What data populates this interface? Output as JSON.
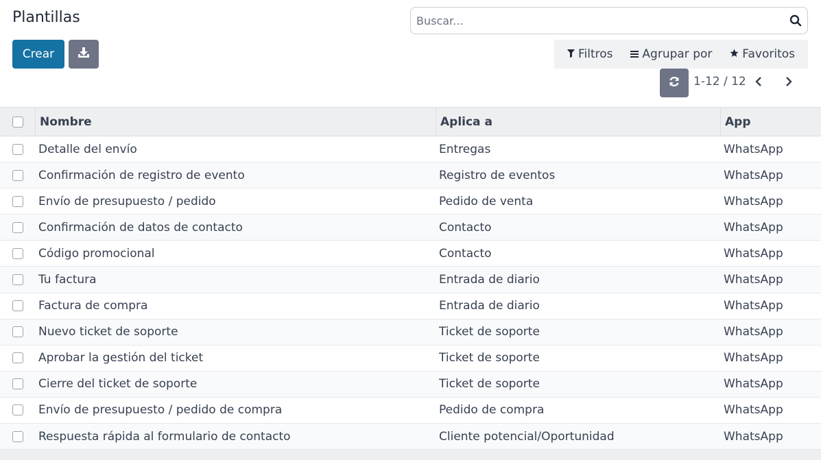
{
  "page": {
    "title": "Plantillas"
  },
  "search": {
    "placeholder": "Buscar...",
    "value": "",
    "icon": "search-icon"
  },
  "toolbar": {
    "create_label": "Crear",
    "download_icon": "download-icon",
    "accent_color": "#1572a3"
  },
  "filters": {
    "filters_label": "Filtros",
    "group_by_label": "Agrupar por",
    "favorites_label": "Favoritos"
  },
  "pager": {
    "value": "1-12 / 12"
  },
  "table": {
    "columns": [
      "Nombre",
      "Aplica a",
      "App"
    ],
    "rows": [
      {
        "name": "Detalle del envío",
        "applies_to": "Entregas",
        "app": "WhatsApp"
      },
      {
        "name": "Confirmación de registro de evento",
        "applies_to": "Registro de eventos",
        "app": "WhatsApp"
      },
      {
        "name": "Envío de presupuesto / pedido",
        "applies_to": "Pedido de venta",
        "app": "WhatsApp"
      },
      {
        "name": "Confirmación de datos de contacto",
        "applies_to": "Contacto",
        "app": "WhatsApp"
      },
      {
        "name": "Código promocional",
        "applies_to": "Contacto",
        "app": "WhatsApp"
      },
      {
        "name": "Tu factura",
        "applies_to": "Entrada de diario",
        "app": "WhatsApp"
      },
      {
        "name": "Factura de compra",
        "applies_to": "Entrada de diario",
        "app": "WhatsApp"
      },
      {
        "name": "Nuevo ticket de soporte",
        "applies_to": "Ticket de soporte",
        "app": "WhatsApp"
      },
      {
        "name": "Aprobar la gestión del ticket",
        "applies_to": "Ticket de soporte",
        "app": "WhatsApp"
      },
      {
        "name": "Cierre del ticket de soporte",
        "applies_to": "Ticket de soporte",
        "app": "WhatsApp"
      },
      {
        "name": "Envío de presupuesto / pedido de compra",
        "applies_to": "Pedido de compra",
        "app": "WhatsApp"
      },
      {
        "name": "Respuesta rápida al formulario de contacto",
        "applies_to": "Cliente potencial/Oportunidad",
        "app": "WhatsApp"
      }
    ]
  }
}
